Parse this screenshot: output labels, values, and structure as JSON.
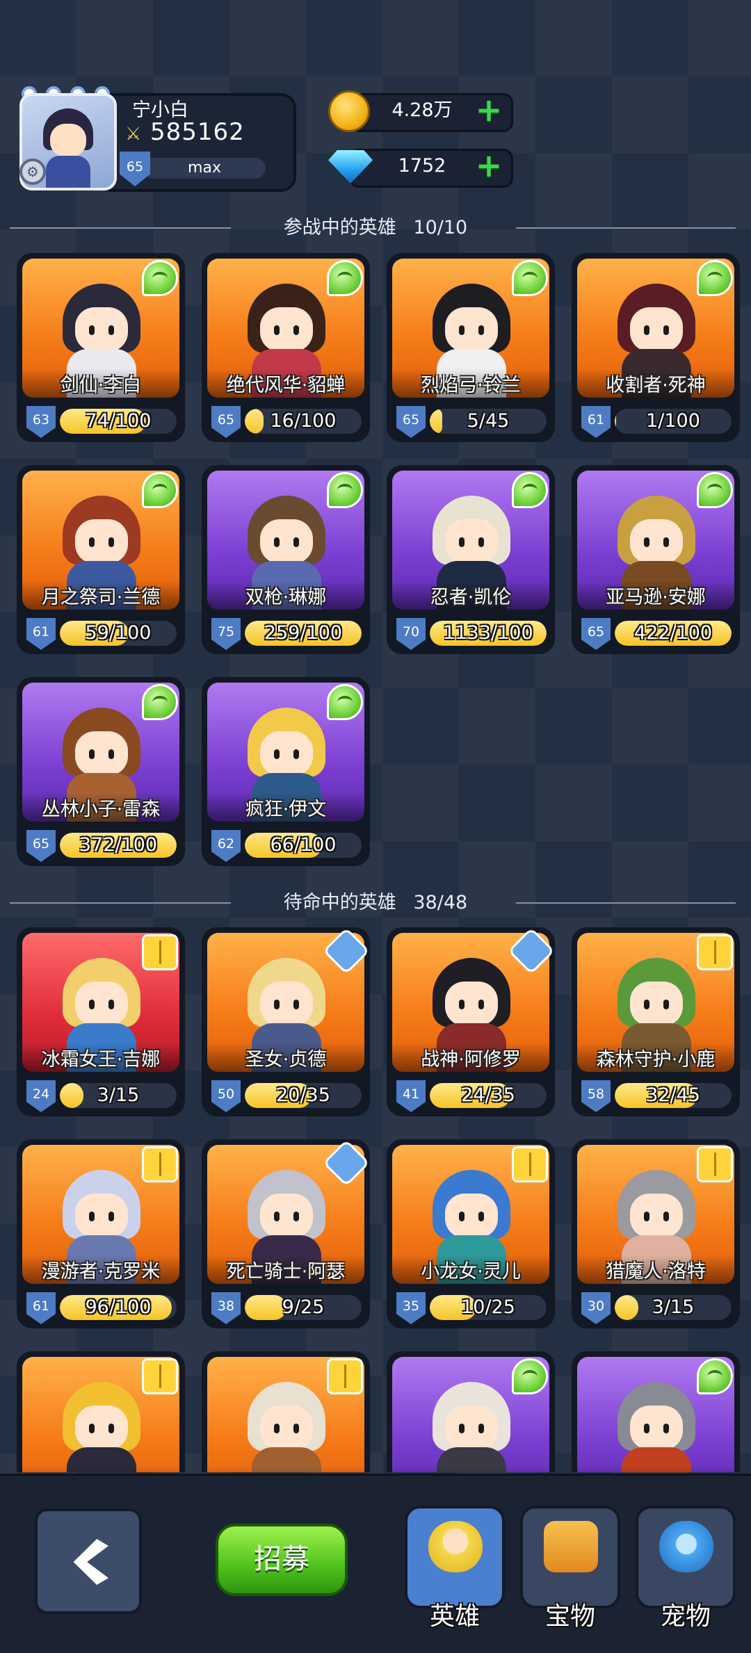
{
  "player": {
    "name": "宁小白",
    "power": "585162",
    "level": "65",
    "level_status": "max"
  },
  "currency": {
    "gold": "4.28万",
    "diamond": "1752"
  },
  "sections": {
    "active": {
      "title": "参战中的英雄",
      "count": "10/10"
    },
    "reserve": {
      "title": "待命中的英雄",
      "count": "38/48"
    }
  },
  "active_heroes": [
    {
      "name": "剑仙·李白",
      "level": "63",
      "progress": "74/100",
      "fraction": 0.74,
      "rarity": "orange",
      "badge": "wing-icon",
      "hair": "#2b2a3a",
      "torso": "#e9e9f0"
    },
    {
      "name": "绝代风华·貂蝉",
      "level": "65",
      "progress": "16/100",
      "fraction": 0.16,
      "rarity": "orange",
      "badge": "wing-icon",
      "hair": "#3a2218",
      "torso": "#c23a4a"
    },
    {
      "name": "烈焰弓·铃兰",
      "level": "65",
      "progress": "5/45",
      "fraction": 0.11,
      "rarity": "orange",
      "badge": "wing-icon",
      "hair": "#1d1d22",
      "torso": "#f0f0f0"
    },
    {
      "name": "收割者·死神",
      "level": "61",
      "progress": "1/100",
      "fraction": 0.01,
      "rarity": "orange",
      "badge": "wing-icon",
      "hair": "#5a1d24",
      "torso": "#3a2a2e"
    },
    {
      "name": "月之祭司·兰德",
      "level": "61",
      "progress": "59/100",
      "fraction": 0.59,
      "rarity": "orange",
      "badge": "wing-icon",
      "hair": "#9c3a22",
      "torso": "#3d5aa0"
    },
    {
      "name": "双枪·琳娜",
      "level": "75",
      "progress": "259/100",
      "fraction": 1,
      "rarity": "purple",
      "badge": "wing-icon",
      "hair": "#6a4a30",
      "torso": "#5a6ab0"
    },
    {
      "name": "忍者·凯伦",
      "level": "70",
      "progress": "1133/100",
      "fraction": 1,
      "rarity": "purple",
      "badge": "wing-icon",
      "hair": "#e8e3d0",
      "torso": "#1f2a44"
    },
    {
      "name": "亚马逊·安娜",
      "level": "65",
      "progress": "422/100",
      "fraction": 1,
      "rarity": "purple",
      "badge": "wing-icon",
      "hair": "#c9a040",
      "torso": "#7a4a22"
    },
    {
      "name": "丛林小子·雷森",
      "level": "65",
      "progress": "372/100",
      "fraction": 1,
      "rarity": "purple",
      "badge": "wing-icon",
      "hair": "#8a4a20",
      "torso": "#a86232"
    },
    {
      "name": "疯狂·伊文",
      "level": "62",
      "progress": "66/100",
      "fraction": 0.66,
      "rarity": "purple",
      "badge": "wing-icon",
      "hair": "#f3c948",
      "torso": "#2d5a8a"
    }
  ],
  "reserve_heroes": [
    {
      "name": "冰霜女王·吉娜",
      "level": "24",
      "progress": "3/15",
      "fraction": 0.2,
      "rarity": "red",
      "badge": "book-icon",
      "hair": "#f2cf6a",
      "torso": "#3a7cc9"
    },
    {
      "name": "圣女·贞德",
      "level": "50",
      "progress": "20/35",
      "fraction": 0.57,
      "rarity": "orange",
      "badge": "sword-icon",
      "hair": "#f0d88a",
      "torso": "#4b5a8a"
    },
    {
      "name": "战神·阿修罗",
      "level": "41",
      "progress": "24/35",
      "fraction": 0.69,
      "rarity": "orange",
      "badge": "sword-icon",
      "hair": "#1e1e24",
      "torso": "#8a2a2a"
    },
    {
      "name": "森林守护·小鹿",
      "level": "58",
      "progress": "32/45",
      "fraction": 0.71,
      "rarity": "orange",
      "badge": "book-icon",
      "hair": "#5a9a3a",
      "torso": "#7a5a30"
    },
    {
      "name": "漫游者·克罗米",
      "level": "61",
      "progress": "96/100",
      "fraction": 0.96,
      "rarity": "orange",
      "badge": "book-icon",
      "hair": "#c9d2ea",
      "torso": "#6a7ab0"
    },
    {
      "name": "死亡骑士·阿瑟",
      "level": "38",
      "progress": "9/25",
      "fraction": 0.36,
      "rarity": "orange",
      "badge": "sword-icon",
      "hair": "#c2c2cc",
      "torso": "#3a2a4a"
    },
    {
      "name": "小龙女·灵儿",
      "level": "35",
      "progress": "10/25",
      "fraction": 0.4,
      "rarity": "orange",
      "badge": "book-icon",
      "hair": "#3a7ad0",
      "torso": "#2e9a9a"
    },
    {
      "name": "猎魔人·洛特",
      "level": "30",
      "progress": "3/15",
      "fraction": 0.2,
      "rarity": "orange",
      "badge": "book-icon",
      "hair": "#9a9aa0",
      "torso": "#e0b0a0"
    },
    {
      "name": "",
      "level": "",
      "progress": "",
      "fraction": 0,
      "rarity": "orange",
      "badge": "book-icon",
      "hair": "#f0c030",
      "torso": "#2a2a3a"
    },
    {
      "name": "",
      "level": "",
      "progress": "",
      "fraction": 0,
      "rarity": "orange",
      "badge": "book-icon",
      "hair": "#e8e0d0",
      "torso": "#a06030"
    },
    {
      "name": "",
      "level": "",
      "progress": "",
      "fraction": 0,
      "rarity": "purple",
      "badge": "wing-icon",
      "hair": "#e8e4dc",
      "torso": "#3a3a44"
    },
    {
      "name": "",
      "level": "",
      "progress": "",
      "fraction": 0,
      "rarity": "purple",
      "badge": "wing-icon",
      "hair": "#8a8a94",
      "torso": "#c04020"
    }
  ],
  "bottom_nav": {
    "back_icon": "back-arrow-icon",
    "recruit_label": "招募",
    "tabs": [
      {
        "label": "英雄",
        "icon": "hero-icon",
        "active": true,
        "color": "#f5d84a"
      },
      {
        "label": "宝物",
        "icon": "treasure-icon",
        "active": false,
        "color": "#f0a030"
      },
      {
        "label": "宠物",
        "icon": "pet-icon",
        "active": false,
        "color": "#4aa8f0"
      }
    ]
  }
}
